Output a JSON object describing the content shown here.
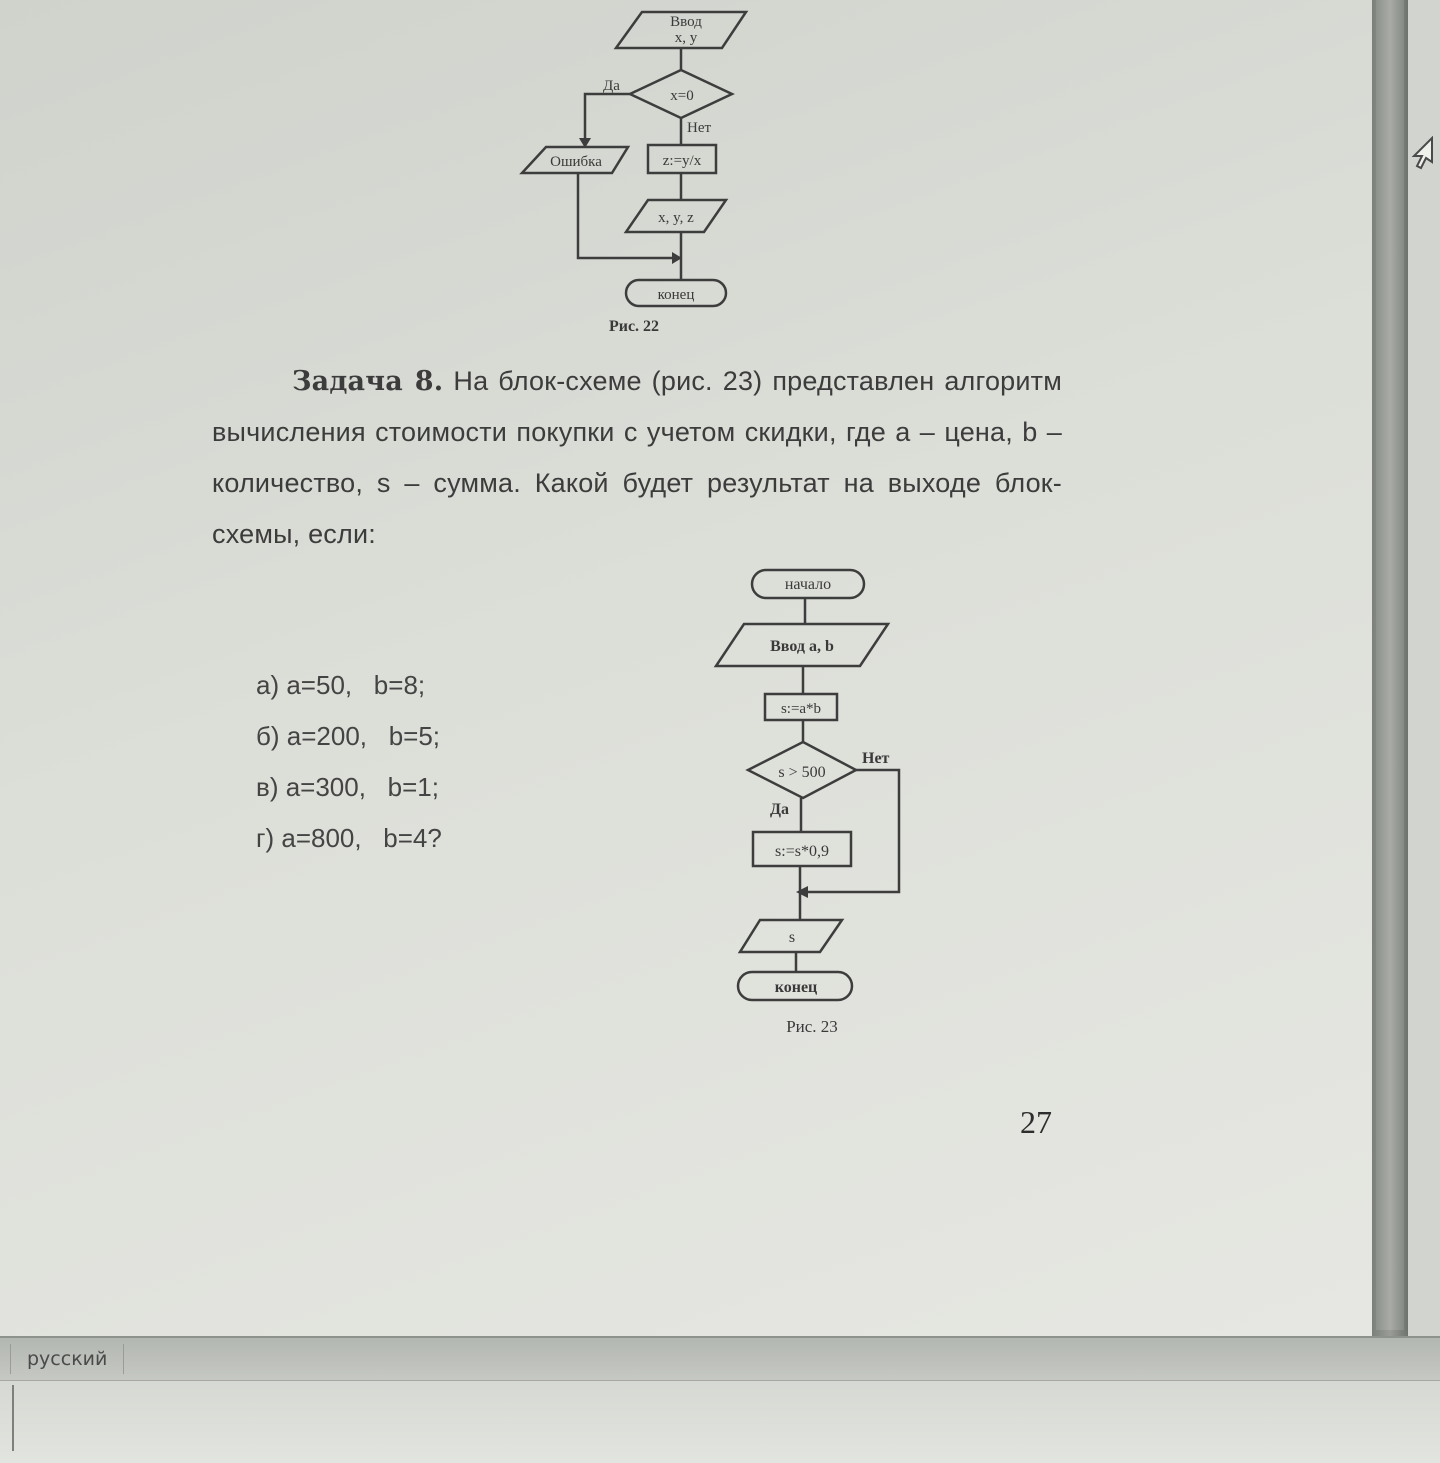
{
  "document": {
    "fig22": {
      "input": [
        "Ввод",
        "x, y"
      ],
      "condition": "x=0",
      "yes": "Да",
      "no": "Нет",
      "error": "Ошибка",
      "assign": "z:=y/x",
      "output": "x, y, z",
      "end": "конец",
      "caption": "Рис. 22"
    },
    "task": {
      "label": "Задача 8.",
      "text": "На блок-схеме (рис. 23) представлен алгоритм вычисления стоимости покупки с учетом скидки, где a – цена, b – количество, s – сумма. Какой будет результат на выходе блок-схемы, если:"
    },
    "options": [
      "а) a=50,   b=8;",
      "б) a=200,   b=5;",
      "в) a=300,   b=1;",
      "г) a=800,   b=4?"
    ],
    "fig23": {
      "start": "начало",
      "input": "Ввод a, b",
      "assign": "s:=a*b",
      "condition": "s > 500",
      "no": "Нет",
      "yes": "Да",
      "discount": "s:=s*0,9",
      "output": "s",
      "end": "конец",
      "caption": "Рис. 23"
    },
    "page_number": "27"
  },
  "statusbar": {
    "language": "русский"
  }
}
